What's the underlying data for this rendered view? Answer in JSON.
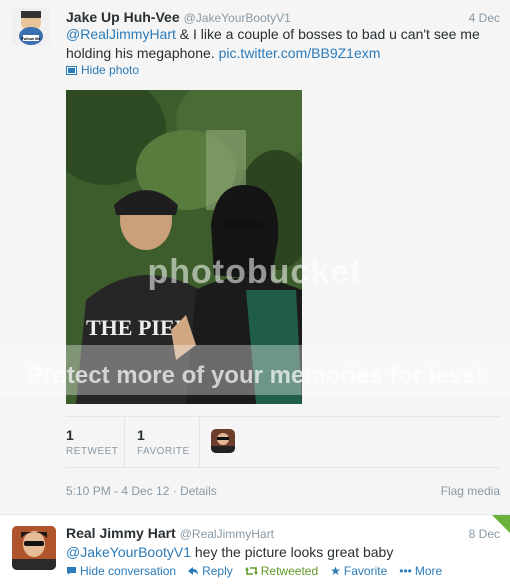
{
  "tweet1": {
    "fullname": "Jake Up Huh-Vee",
    "handle": "@JakeYourBootyV1",
    "date": "4 Dec",
    "mention": "@RealJimmyHart",
    "text_line1": " & I like a couple of bosses to bad u can't see me",
    "text_line2": "holding his megaphone. ",
    "photo_link": "pic.twitter.com/BB9Z1exm",
    "hide_photo": "Hide photo",
    "retweets_count": "1",
    "retweets_label": "RETWEET",
    "favorites_count": "1",
    "favorites_label": "FAVORITE",
    "timestamp": "5:10 PM - 4 Dec 12",
    "details": "Details",
    "flag_media": "Flag media"
  },
  "watermark": {
    "line1": "photobucket",
    "line2": "Protect more of your memories for less!"
  },
  "tweet2": {
    "fullname": "Real Jimmy Hart",
    "handle": "@RealJimmyHart",
    "date": "8 Dec",
    "mention": "@JakeYourBootyV1",
    "text": " hey the picture looks great baby",
    "actions": {
      "hide_conversation": "Hide conversation",
      "reply": "Reply",
      "retweeted": "Retweeted",
      "favorite": "Favorite",
      "more": "More"
    }
  },
  "colors": {
    "link": "#2b7bb9",
    "retweeted": "#609928",
    "muted": "#8899a6"
  }
}
